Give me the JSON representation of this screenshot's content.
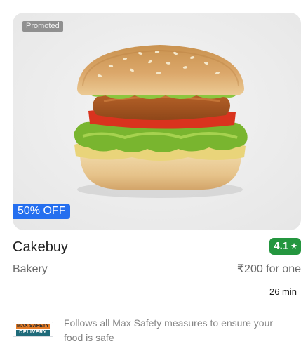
{
  "restaurant": {
    "promoted_label": "Promoted",
    "discount_label": "50% OFF",
    "name": "Cakebuy",
    "rating": "4.1",
    "rating_icon": "star-icon",
    "cuisine": "Bakery",
    "price": "₹200 for one",
    "delivery_time": "26 min",
    "image_subject": "burger-photo"
  },
  "safety": {
    "badge_top": "MAX SAFETY",
    "badge_bottom": "DELIVERY",
    "text": "Follows all Max Safety measures to ensure your food is safe"
  },
  "colors": {
    "rating_bg": "#24963f",
    "discount_bg": "#256fef",
    "text_primary": "#1c1c1c",
    "text_secondary": "#696969"
  }
}
